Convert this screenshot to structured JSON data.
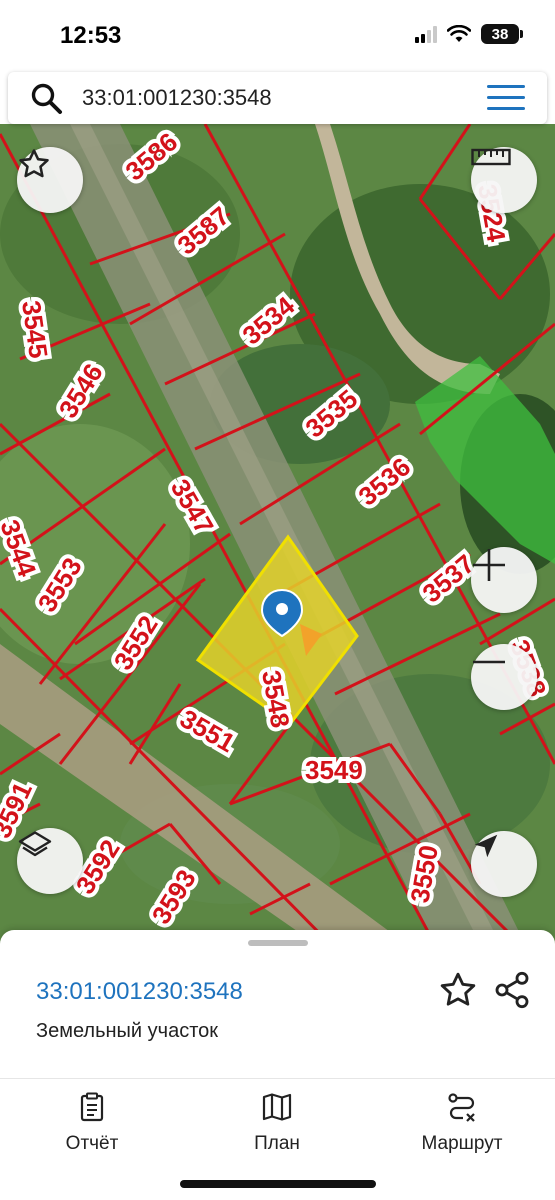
{
  "status_bar": {
    "time": "12:53",
    "battery": "38",
    "icons": [
      "cellular-signal-icon",
      "wifi-icon",
      "battery-icon"
    ]
  },
  "search": {
    "query": "33:01:001230:3548",
    "icon": "search-icon",
    "menu_icon": "menu-icon"
  },
  "map": {
    "parcels": [
      "3586",
      "3587",
      "3545",
      "3534",
      "3546",
      "3535",
      "3536",
      "3547",
      "3553",
      "3537",
      "3552",
      "3548",
      "3551",
      "3549",
      "3591",
      "3592",
      "3550",
      "3593",
      "3538",
      "3524",
      "3544"
    ],
    "selected_parcel": "3548",
    "controls": [
      "star-icon",
      "ruler-icon",
      "zoom-in-icon",
      "zoom-out-icon",
      "layers-icon",
      "navigation-arrow-icon"
    ],
    "colors": {
      "parcel_border": "#d3121a",
      "selected_fill": "#e3d12a",
      "selected_border": "#f0e000",
      "marker": "#1e73be"
    }
  },
  "sheet": {
    "parcel_id": "33:01:001230:3548",
    "parcel_type": "Земельный участок"
  },
  "tabs": [
    {
      "label": "Отчёт",
      "icon": "clipboard-icon"
    },
    {
      "label": "План",
      "icon": "map-icon"
    },
    {
      "label": "Маршрут",
      "icon": "route-icon"
    }
  ],
  "accent": "#1e73be"
}
